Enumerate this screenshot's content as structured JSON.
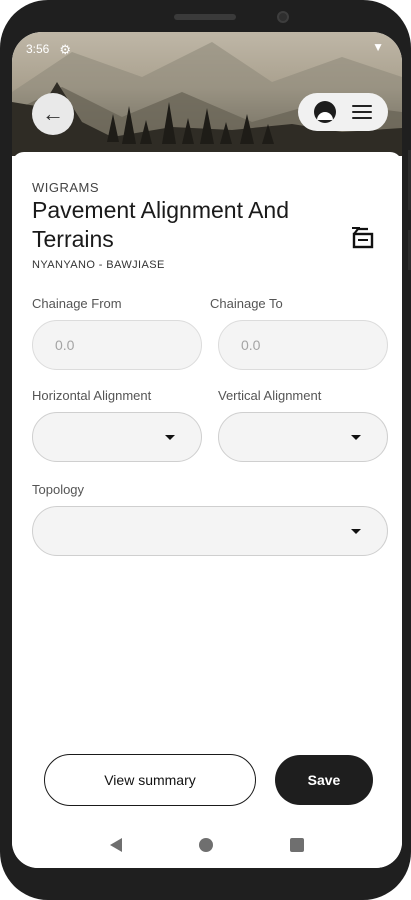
{
  "status_bar": {
    "time": "3:56",
    "settings_icon": "gear-icon",
    "signal_icon": "signal-icon"
  },
  "header": {
    "back_icon": "arrow-left-icon",
    "logo_icon": "app-logo-icon",
    "menu_icon": "hamburger-menu-icon"
  },
  "form": {
    "company": "WIGRAMS",
    "title": "Pavement Alignment And Terrains",
    "route": "NYANYANO - BAWJIASE",
    "document_icon": "document-stack-icon",
    "chainage_from": {
      "label": "Chainage From",
      "placeholder": "0.0"
    },
    "chainage_to": {
      "label": "Chainage To",
      "placeholder": "0.0"
    },
    "horizontal_alignment": {
      "label": "Horizontal Alignment",
      "value": ""
    },
    "vertical_alignment": {
      "label": "Vertical Alignment",
      "value": ""
    },
    "topology": {
      "label": "Topology",
      "value": ""
    }
  },
  "actions": {
    "view_summary": "View summary",
    "save": "Save"
  },
  "android_nav": {
    "back_icon": "triangle-back-icon",
    "home_icon": "circle-home-icon",
    "recents_icon": "square-recents-icon"
  },
  "colors": {
    "primary_dark": "#1e1e1e",
    "field_bg": "#f4f4f4",
    "field_border": "#d6d6d6"
  }
}
